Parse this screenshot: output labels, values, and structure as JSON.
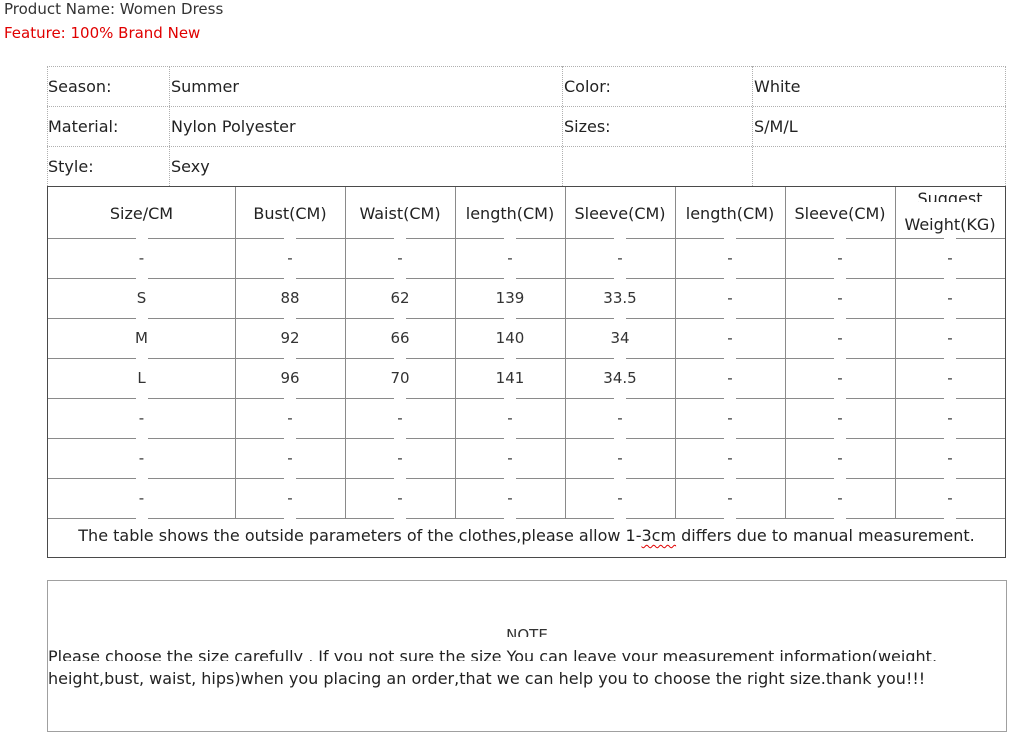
{
  "product_name": "Product Name: Women Dress",
  "feature": "Feature: 100% Brand New",
  "specs": {
    "season_label": "Season:",
    "season_value": "Summer",
    "color_label": "Color:",
    "color_value": "White",
    "material_label": "Material:",
    "material_value": "Nylon Polyester",
    "sizes_label": "Sizes:",
    "sizes_value": "S/M/L",
    "style_label": "Style:",
    "style_value": "Sexy"
  },
  "size_table": {
    "headers": [
      "Size/CM",
      "Bust(CM)",
      "Waist(CM)",
      "length(CM)",
      "Sleeve(CM)",
      "length(CM)",
      "Sleeve(CM)"
    ],
    "suggest_header_top": "Suggest",
    "suggest_header_bottom": "Weight(KG)",
    "rows": [
      [
        "-",
        "-",
        "-",
        "-",
        "-",
        "-",
        "-",
        "-"
      ],
      [
        "S",
        "88",
        "62",
        "139",
        "33.5",
        "-",
        "-",
        "-"
      ],
      [
        "M",
        "92",
        "66",
        "140",
        "34",
        "-",
        "-",
        "-"
      ],
      [
        "L",
        "96",
        "70",
        "141",
        "34.5",
        "-",
        "-",
        "-"
      ],
      [
        "-",
        "-",
        "-",
        "-",
        "-",
        "-",
        "-",
        "-"
      ],
      [
        "-",
        "-",
        "-",
        "-",
        "-",
        "-",
        "-",
        "-"
      ],
      [
        "-",
        "-",
        "-",
        "-",
        "-",
        "-",
        "-",
        "-"
      ]
    ],
    "footnote_before": "The table shows the outside parameters of the clothes,please allow 1-",
    "footnote_mark": "3cm",
    "footnote_after": " differs due to manual measurement."
  },
  "note": {
    "title": "NOTE",
    "line1": "Please choose the size carefully , If you not sure the size You can leave your measurement information(weight,",
    "line2": "height,bust, waist, hips)when you placing an order,that we can help you to choose the right size.thank you!!!"
  },
  "colors": {
    "feature_text": "#e00000",
    "text": "#222222",
    "border": "#4a4a4a"
  }
}
